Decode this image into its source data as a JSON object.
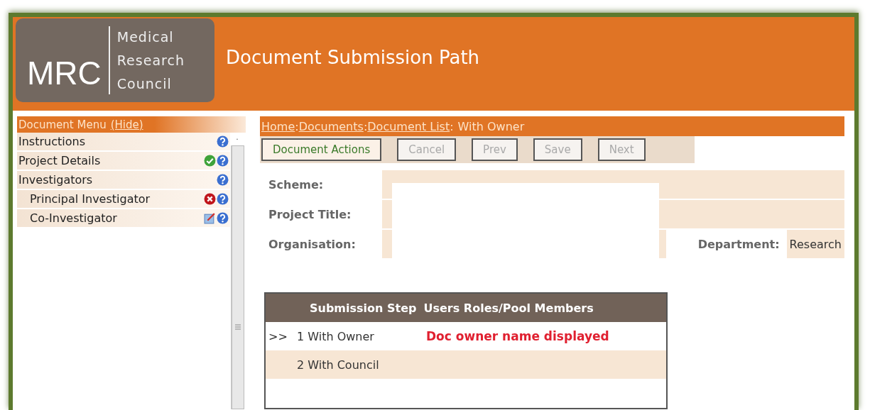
{
  "header": {
    "logo": {
      "acronym": "MRC",
      "lines": [
        "Medical",
        "Research",
        "Council"
      ]
    },
    "title": "Document Submission Path"
  },
  "sidebar": {
    "title": "Document Menu",
    "toggle_link": "(Hide)",
    "items": [
      {
        "label": "Instructions",
        "kind": "plain"
      },
      {
        "label": "Project Details",
        "kind": "complete"
      },
      {
        "label": "Investigators",
        "kind": "plain",
        "children": [
          {
            "label": "Principal Investigator",
            "kind": "error"
          },
          {
            "label": "Co-Investigator",
            "kind": "edit"
          }
        ]
      }
    ]
  },
  "breadcrumb": {
    "links": [
      "Home",
      "Documents",
      "Document List"
    ],
    "separator": ":",
    "current": "With Owner"
  },
  "toolbar": [
    {
      "label": "Document Actions",
      "disabled": false
    },
    {
      "label": "Cancel",
      "disabled": true
    },
    {
      "label": "Prev",
      "disabled": true
    },
    {
      "label": "Save",
      "disabled": true
    },
    {
      "label": "Next",
      "disabled": true
    }
  ],
  "form": {
    "fields": [
      {
        "label": "Scheme:"
      },
      {
        "label": "Project Title:"
      },
      {
        "label": "Organisation:"
      }
    ],
    "department": {
      "label": "Department:",
      "value": "Research"
    }
  },
  "table": {
    "columns": [
      "Submission Step",
      "Users Roles/Pool Members"
    ],
    "rows": [
      {
        "marker": ">>",
        "step": "1 With Owner",
        "users": "Doc owner name displayed"
      },
      {
        "step": "2 With Council"
      }
    ]
  }
}
